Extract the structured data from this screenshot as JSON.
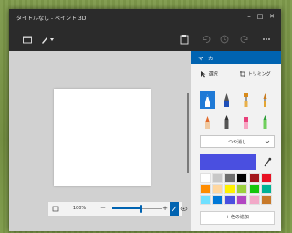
{
  "app": {
    "title": "タイトルなし - ペイント 3D"
  },
  "window_controls": {
    "minimize": "–",
    "maximize": "□",
    "close": "✕"
  },
  "zoom": {
    "percent": "100%",
    "minus": "—",
    "plus": "+"
  },
  "panel": {
    "title": "マーカー",
    "select_label": "選択",
    "trim_label": "トリミング",
    "brushes": [
      {
        "name": "marker",
        "selected": true
      },
      {
        "name": "calligraphy-pen",
        "selected": false
      },
      {
        "name": "oil-brush",
        "selected": false
      },
      {
        "name": "watercolor",
        "selected": false
      },
      {
        "name": "pixel-pen",
        "selected": false
      },
      {
        "name": "pencil",
        "selected": false
      },
      {
        "name": "eraser",
        "selected": false
      },
      {
        "name": "crayon",
        "selected": false
      }
    ],
    "finish": "つや消し",
    "current_color": "#4a4fe0",
    "palette": [
      "#ffffff",
      "#c8c8c8",
      "#6d6d6d",
      "#000000",
      "#a3161b",
      "#e81123",
      "#ff8c00",
      "#ffd7a0",
      "#fff100",
      "#9bd03d",
      "#16c60c",
      "#00b294",
      "#70e0ff",
      "#0078d7",
      "#4a4fe0",
      "#b146c2",
      "#f2a9c8",
      "#c87a2a"
    ],
    "add_color": "+ 色の追加"
  }
}
